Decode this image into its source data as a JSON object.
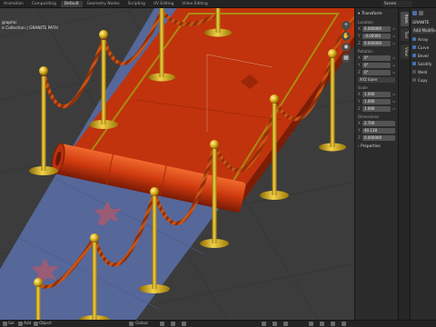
{
  "workspace_tabs": [
    "Animation",
    "Compositing",
    "Default",
    "Geometry Nodes",
    "Scripting",
    "UV Editing",
    "Video Editing"
  ],
  "active_tab": "Default",
  "scene": {
    "name": "Scene"
  },
  "viewport": {
    "view_label": "graphic",
    "collection_label": "e Collection | GRANITE PATH"
  },
  "npanel": {
    "title": "Transform",
    "location_label": "Location",
    "location": [
      {
        "axis": "X",
        "value": "0.000000"
      },
      {
        "axis": "Y",
        "value": "-0.00000"
      },
      {
        "axis": "Z",
        "value": "0.000000"
      }
    ],
    "rotation_label": "Rotation",
    "rotation": [
      {
        "axis": "X",
        "value": "0°"
      },
      {
        "axis": "Y",
        "value": "0°"
      },
      {
        "axis": "Z",
        "value": "0°"
      }
    ],
    "rotation_mode": "XYZ Euler",
    "scale_label": "Scale",
    "scale": [
      {
        "axis": "X",
        "value": "1.000"
      },
      {
        "axis": "Y",
        "value": "1.000"
      },
      {
        "axis": "Z",
        "value": "1.000"
      }
    ],
    "dimensions_label": "Dimensions",
    "dimensions": [
      {
        "axis": "X",
        "value": "2.700"
      },
      {
        "axis": "Y",
        "value": "40.138"
      },
      {
        "axis": "Z",
        "value": "0.000000"
      }
    ],
    "properties_label": "Properties"
  },
  "sidetabs": [
    "Item",
    "Tool",
    "View"
  ],
  "properties": {
    "object_name": "GRANITE",
    "add_modifier": "Add Modifier",
    "modifiers": [
      {
        "name": "Array",
        "enabled": true
      },
      {
        "name": "Curve",
        "enabled": true
      },
      {
        "name": "Bevel",
        "enabled": true
      },
      {
        "name": "Solidify",
        "enabled": true
      },
      {
        "name": "Weld",
        "enabled": false
      },
      {
        "name": "Copy",
        "enabled": false
      }
    ]
  },
  "statusbar": {
    "select": "Sel",
    "add": "Add",
    "object": "Object",
    "global": "Global"
  },
  "colors": {
    "carpet": "#c0330c",
    "carpet_border": "#9a7d10",
    "granite": "#56679a",
    "gold": "#d6ad15",
    "rope": "#b34a10",
    "accent_blue": "#4772b3"
  }
}
